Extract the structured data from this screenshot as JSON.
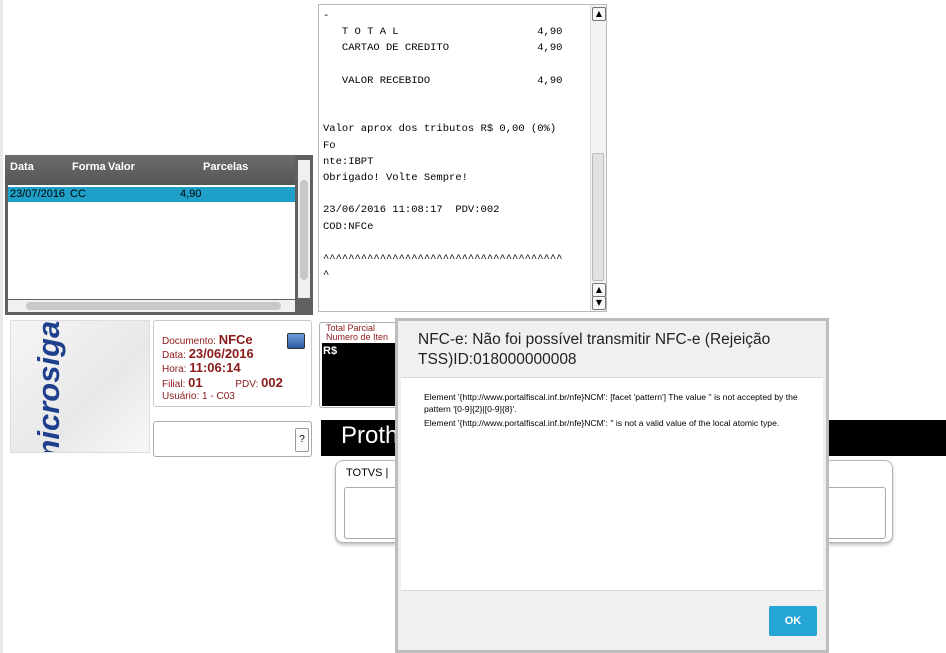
{
  "receipt": {
    "lines": [
      "-",
      "   T O T A L                      4,90",
      "   CARTAO DE CREDITO              4,90",
      "",
      "   VALOR RECEBIDO                 4,90",
      "",
      "",
      "Valor aprox dos tributos R$ 0,00 (0%)",
      "Fo",
      "nte:IBPT",
      "Obrigado! Volte Sempre!",
      "",
      "23/06/2016 11:08:17  PDV:002",
      "COD:NFCe",
      "",
      "^^^^^^^^^^^^^^^^^^^^^^^^^^^^^^^^^^^^^^",
      "^"
    ],
    "scroll_up": "▲",
    "scroll_down": "▼"
  },
  "payments": {
    "columns": [
      "Data",
      "Forma",
      "Valor",
      "Parcelas"
    ],
    "rows": [
      {
        "data": "23/07/2016",
        "forma": "CC",
        "valor": "4,90",
        "parcelas": ""
      }
    ]
  },
  "logo": {
    "text": "microsiga"
  },
  "info": {
    "documento_label": "Documento:",
    "documento": "NFCe",
    "data_label": "Data:",
    "data": "23/06/2016",
    "hora_label": "Hora:",
    "hora": "11:06:14",
    "filial_label": "Filial:",
    "filial": "01",
    "pdv_label": "PDV:",
    "pdv": "002",
    "usuario_label": "Usuário:",
    "usuario": "1 - C03"
  },
  "help_button": "?",
  "total_parcial": {
    "label": "Total Parcial",
    "items_label": "Numero de Iten",
    "value": "R$"
  },
  "banner": {
    "text": "Proth"
  },
  "totvs": {
    "label": "TOTVS |"
  },
  "dialog": {
    "title": "NFC-e: Não foi possível transmitir NFC-e (Rejeição TSS)ID:018000000008",
    "message_1": "Element '{http://www.portalfiscal.inf.br/nfe}NCM': [facet 'pattern'] The value '' is not accepted by the pattern '[0-9]{2}|[0-9]{8}'.",
    "message_2": "Element '{http://www.portalfiscal.inf.br/nfe}NCM': '' is not a valid value of the local atomic type.",
    "ok_label": "OK"
  }
}
